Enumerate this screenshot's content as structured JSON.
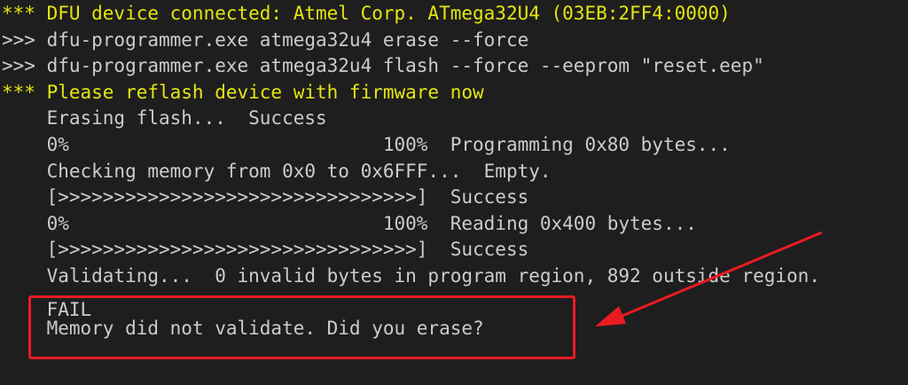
{
  "terminal": {
    "colors": {
      "background": "#1e1e1e",
      "text": "#cccccc",
      "highlight": "#e5e510",
      "annotation": "#e81b23"
    },
    "lines": {
      "l1": "*** DFU device connected: Atmel Corp. ATmega32U4 (03EB:2FF4:0000)",
      "l2": ">>> dfu-programmer.exe atmega32u4 erase --force",
      "l3": ">>> dfu-programmer.exe atmega32u4 flash --force --eeprom \"reset.eep\"",
      "l4": "*** Please reflash device with firmware now",
      "l5": "    Erasing flash...  Success",
      "l6": "    0%                            100%  Programming 0x80 bytes...",
      "l7": "    Checking memory from 0x0 to 0x6FFF...  Empty.",
      "l8": "    [>>>>>>>>>>>>>>>>>>>>>>>>>>>>>>>>]  Success",
      "l9": "    0%                            100%  Reading 0x400 bytes...",
      "l10": "    [>>>>>>>>>>>>>>>>>>>>>>>>>>>>>>>>]  Success",
      "l11": "    Validating...  0 invalid bytes in program region, 892 outside region.",
      "l12": "    FAIL",
      "l13": "    Memory did not validate. Did you erase?"
    }
  }
}
